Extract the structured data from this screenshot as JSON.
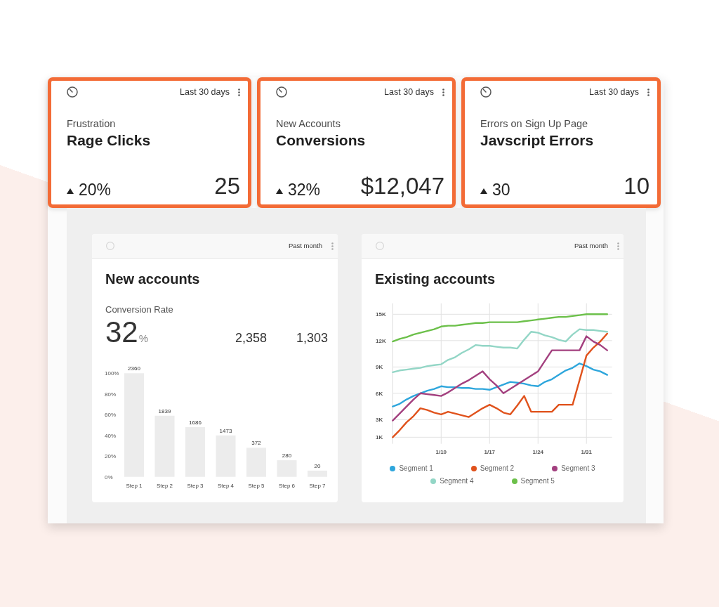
{
  "kpi_cards": [
    {
      "range": "Last 30 days",
      "subtitle": "Frustration",
      "title": "Rage Clicks",
      "change": "20%",
      "value": "25"
    },
    {
      "range": "Last 30 days",
      "subtitle": "New Accounts",
      "title": "Conversions",
      "change": "32%",
      "value": "$12,047"
    },
    {
      "range": "Last 30 days",
      "subtitle": "Errors on Sign Up Page",
      "title": "Javscript Errors",
      "change": "30",
      "value": "10"
    }
  ],
  "new_accounts": {
    "range": "Past month",
    "title": "New accounts",
    "metric_label": "Conversion Rate",
    "metric_value": "32",
    "metric_unit": "%",
    "stats": [
      "2,358",
      "1,303"
    ],
    "chart_data": {
      "type": "bar",
      "categories": [
        "Step 1",
        "Step 2",
        "Step 3",
        "Step 4",
        "Step 5",
        "Step 6",
        "Step 7"
      ],
      "values": [
        100,
        59,
        48,
        40,
        28,
        16,
        6
      ],
      "ylim": [
        0,
        100
      ],
      "yticks": [
        {
          "value": 0,
          "label": "0%"
        },
        {
          "value": 20,
          "label": "20%"
        },
        {
          "value": 40,
          "label": "40%"
        },
        {
          "value": 60,
          "label": "60%"
        },
        {
          "value": 80,
          "label": "80%"
        },
        {
          "value": 100,
          "label": "100%"
        }
      ],
      "annotations": [
        {
          "x": "Step 1",
          "y": 100,
          "text": "2360"
        },
        {
          "x": "Step 2",
          "y": 59,
          "text": "1839"
        },
        {
          "x": "Step 3",
          "y": 48,
          "text": "1686"
        },
        {
          "x": "Step 4",
          "y": 40,
          "text": "1473"
        },
        {
          "x": "Step 5",
          "y": 28,
          "text": "372"
        },
        {
          "x": "Step 6",
          "y": 16,
          "text": "280"
        },
        {
          "x": "Step 7",
          "y": 6,
          "text": "20"
        }
      ]
    }
  },
  "existing_accounts": {
    "range": "Past month",
    "title": "Existing accounts",
    "chart_data": {
      "type": "line",
      "grid": true,
      "categories": [
        null,
        null,
        null,
        null,
        null,
        null,
        null,
        "1/10",
        null,
        null,
        null,
        null,
        null,
        null,
        "1/17",
        null,
        null,
        null,
        null,
        null,
        null,
        "1/24",
        null,
        null,
        null,
        null,
        null,
        null,
        "1/31",
        null,
        null,
        null
      ],
      "ylim": [
        0.25,
        16.25
      ],
      "yticks": [
        {
          "value": 15,
          "label": "15K"
        },
        {
          "value": 12,
          "label": "12K"
        },
        {
          "value": 9,
          "label": "9K"
        },
        {
          "value": 6,
          "label": "6K"
        },
        {
          "value": 3,
          "label": "3K"
        },
        {
          "value": 1,
          "label": "1K"
        }
      ],
      "series": [
        {
          "name": "Segment 1",
          "color": "#2ea6dc",
          "values": [
            4.5,
            4.8,
            5.3,
            5.7,
            6.0,
            6.3,
            6.5,
            6.8,
            6.7,
            6.7,
            6.6,
            6.6,
            6.5,
            6.5,
            6.4,
            6.7,
            7.0,
            7.3,
            7.2,
            7.1,
            6.9,
            6.8,
            7.3,
            7.6,
            8.1,
            8.6,
            8.9,
            9.4,
            9.1,
            8.7,
            8.5,
            8.1
          ]
        },
        {
          "name": "Segment 2",
          "color": "#e0521c",
          "values": [
            1.0,
            1.8,
            2.7,
            3.4,
            4.3,
            4.1,
            3.8,
            3.6,
            3.9,
            3.7,
            3.5,
            3.3,
            3.8,
            4.3,
            4.7,
            4.3,
            3.8,
            3.6,
            4.6,
            5.7,
            3.9,
            3.9,
            3.9,
            3.9,
            4.7,
            4.7,
            4.7,
            7.5,
            10.3,
            11.2,
            11.9,
            12.8
          ]
        },
        {
          "name": "Segment 3",
          "color": "#a3407f",
          "values": [
            2.9,
            3.7,
            4.5,
            5.3,
            6.0,
            5.9,
            5.8,
            5.7,
            6.1,
            6.6,
            7.1,
            7.5,
            8.0,
            8.5,
            7.6,
            6.9,
            6.0,
            6.5,
            7.0,
            7.5,
            8.0,
            8.5,
            9.7,
            10.9,
            10.9,
            10.9,
            10.9,
            10.9,
            12.5,
            11.9,
            11.5,
            10.9
          ]
        },
        {
          "name": "Segment 4",
          "color": "#93d6c6",
          "values": [
            8.4,
            8.6,
            8.7,
            8.8,
            8.9,
            9.1,
            9.2,
            9.3,
            9.8,
            10.1,
            10.6,
            11.0,
            11.5,
            11.4,
            11.4,
            11.3,
            11.2,
            11.2,
            11.1,
            12.1,
            13.0,
            12.9,
            12.6,
            12.4,
            12.1,
            11.9,
            12.7,
            13.3,
            13.2,
            13.2,
            13.1,
            13.0
          ]
        },
        {
          "name": "Segment 5",
          "color": "#6cc04a",
          "values": [
            11.9,
            12.2,
            12.4,
            12.7,
            12.9,
            13.1,
            13.3,
            13.6,
            13.7,
            13.7,
            13.8,
            13.9,
            14.0,
            14.0,
            14.1,
            14.1,
            14.1,
            14.1,
            14.1,
            14.2,
            14.3,
            14.4,
            14.5,
            14.6,
            14.7,
            14.7,
            14.8,
            14.9,
            15.0,
            15.0,
            15.0,
            15.0
          ]
        }
      ]
    }
  }
}
